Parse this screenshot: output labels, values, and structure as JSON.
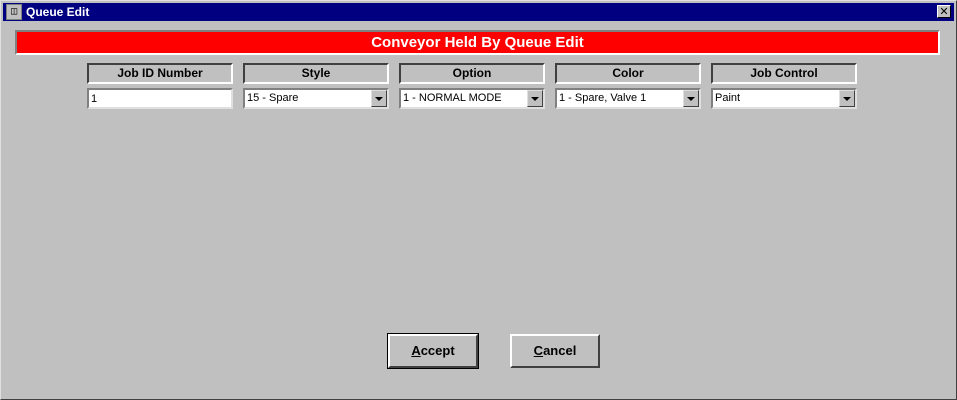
{
  "window": {
    "title": "Queue Edit",
    "icon": "app-icon",
    "close_glyph": "✕"
  },
  "banner": {
    "text": "Conveyor Held By Queue Edit",
    "color": "#ff0000"
  },
  "columns": [
    {
      "header": "Job ID Number",
      "value": "1",
      "type": "text"
    },
    {
      "header": "Style",
      "value": "15 - Spare",
      "type": "select"
    },
    {
      "header": "Option",
      "value": "1 - NORMAL MODE",
      "type": "select"
    },
    {
      "header": "Color",
      "value": "1 - Spare, Valve 1",
      "type": "select"
    },
    {
      "header": "Job Control",
      "value": "Paint",
      "type": "select"
    }
  ],
  "buttons": {
    "accept": {
      "mnemonic": "A",
      "rest": "ccept"
    },
    "cancel": {
      "mnemonic": "C",
      "rest": "ancel"
    }
  },
  "colors": {
    "titlebar": "#000080",
    "face": "#c0c0c0"
  }
}
